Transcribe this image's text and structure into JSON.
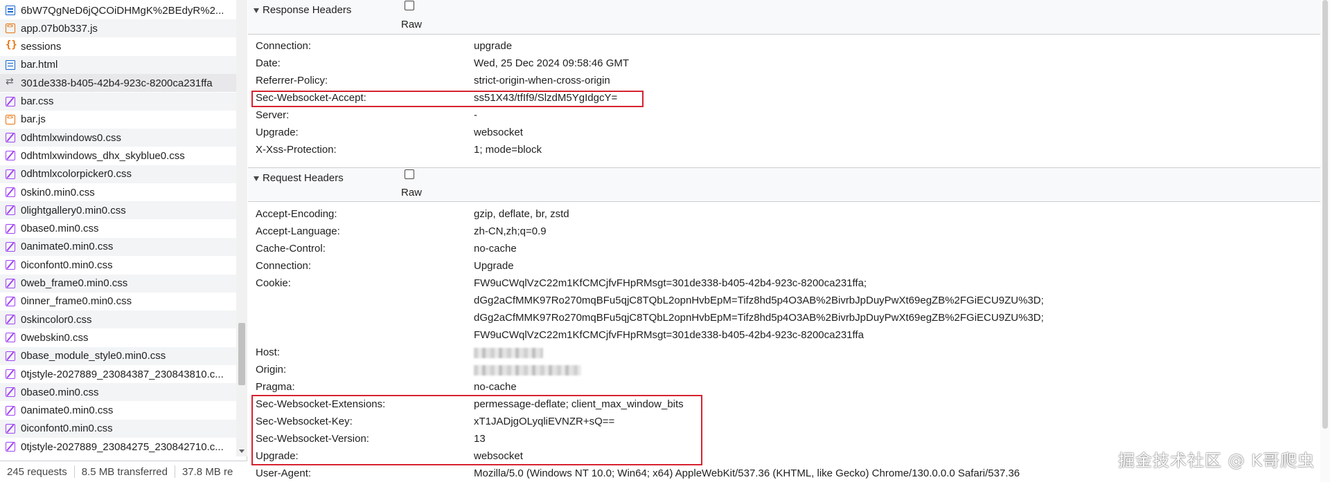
{
  "file_list": {
    "items": [
      {
        "name": "6bW7QgNeD6jQCOiDHMgK%2BEdyR%2...",
        "icon": "document-icon"
      },
      {
        "name": "app.07b0b337.js",
        "icon": "script-icon"
      },
      {
        "name": "sessions",
        "icon": "json-braces-icon"
      },
      {
        "name": "bar.html",
        "icon": "document-icon"
      },
      {
        "name": "301de338-b405-42b4-923c-8200ca231ffa",
        "icon": "websocket-icon"
      },
      {
        "name": "bar.css",
        "icon": "stylesheet-icon"
      },
      {
        "name": "bar.js",
        "icon": "script-icon"
      },
      {
        "name": "0dhtmlxwindows0.css",
        "icon": "stylesheet-icon"
      },
      {
        "name": "0dhtmlxwindows_dhx_skyblue0.css",
        "icon": "stylesheet-icon"
      },
      {
        "name": "0dhtmlxcolorpicker0.css",
        "icon": "stylesheet-icon"
      },
      {
        "name": "0skin0.min0.css",
        "icon": "stylesheet-icon"
      },
      {
        "name": "0lightgallery0.min0.css",
        "icon": "stylesheet-icon"
      },
      {
        "name": "0base0.min0.css",
        "icon": "stylesheet-icon"
      },
      {
        "name": "0animate0.min0.css",
        "icon": "stylesheet-icon"
      },
      {
        "name": "0iconfont0.min0.css",
        "icon": "stylesheet-icon"
      },
      {
        "name": "0web_frame0.min0.css",
        "icon": "stylesheet-icon"
      },
      {
        "name": "0inner_frame0.min0.css",
        "icon": "stylesheet-icon"
      },
      {
        "name": "0skincolor0.css",
        "icon": "stylesheet-icon"
      },
      {
        "name": "0webskin0.css",
        "icon": "stylesheet-icon"
      },
      {
        "name": "0base_module_style0.min0.css",
        "icon": "stylesheet-icon"
      },
      {
        "name": "0tjstyle-2027889_23084387_230843810.c...",
        "icon": "stylesheet-icon"
      },
      {
        "name": "0base0.min0.css",
        "icon": "stylesheet-icon"
      },
      {
        "name": "0animate0.min0.css",
        "icon": "stylesheet-icon"
      },
      {
        "name": "0iconfont0.min0.css",
        "icon": "stylesheet-icon"
      },
      {
        "name": "0tjstyle-2027889_23084275_230842710.c...",
        "icon": "stylesheet-icon"
      }
    ],
    "selected_index": 4
  },
  "status_bar": {
    "requests": "245 requests",
    "transferred": "8.5 MB transferred",
    "resources": "37.8 MB re"
  },
  "response_headers": {
    "title": "Response Headers",
    "raw_label": "Raw",
    "raw_checked": false,
    "rows": [
      {
        "name": "Connection:",
        "value": "upgrade"
      },
      {
        "name": "Date:",
        "value": "Wed, 25 Dec 2024 09:58:46 GMT"
      },
      {
        "name": "Referrer-Policy:",
        "value": "strict-origin-when-cross-origin"
      },
      {
        "name": "Sec-Websocket-Accept:",
        "value": "ss51X43/tfIf9/SlzdM5YgIdgcY="
      },
      {
        "name": "Server:",
        "value": "-"
      },
      {
        "name": "Upgrade:",
        "value": "websocket"
      },
      {
        "name": "X-Xss-Protection:",
        "value": "1; mode=block"
      }
    ]
  },
  "request_headers": {
    "title": "Request Headers",
    "raw_label": "Raw",
    "raw_checked": false,
    "rows": [
      {
        "name": "Accept-Encoding:",
        "value": "gzip, deflate, br, zstd"
      },
      {
        "name": "Accept-Language:",
        "value": "zh-CN,zh;q=0.9"
      },
      {
        "name": "Cache-Control:",
        "value": "no-cache"
      },
      {
        "name": "Connection:",
        "value": "Upgrade"
      },
      {
        "name": "Cookie:",
        "value": "FW9uCWqlVzC22m1KfCMCjfvFHpRMsgt=301de338-b405-42b4-923c-8200ca231ffa;"
      },
      {
        "name": "",
        "value": "dGg2aCfMMK97Ro270mqBFu5qjC8TQbL2opnHvbEpM=Tifz8hd5p4O3AB%2BivrbJpDuyPwXt69egZB%2FGiECU9ZU%3D;"
      },
      {
        "name": "",
        "value": "dGg2aCfMMK97Ro270mqBFu5qjC8TQbL2opnHvbEpM=Tifz8hd5p4O3AB%2BivrbJpDuyPwXt69egZB%2FGiECU9ZU%3D;"
      },
      {
        "name": "",
        "value": "FW9uCWqlVzC22m1KfCMCjfvFHpRMsgt=301de338-b405-42b4-923c-8200ca231ffa"
      },
      {
        "name": "Host:",
        "value": "",
        "redacted": true
      },
      {
        "name": "Origin:",
        "value": "",
        "redacted": true
      },
      {
        "name": "Pragma:",
        "value": "no-cache"
      },
      {
        "name": "Sec-Websocket-Extensions:",
        "value": "permessage-deflate; client_max_window_bits"
      },
      {
        "name": "Sec-Websocket-Key:",
        "value": "xT1JADjgOLyqliEVNZR+sQ=="
      },
      {
        "name": "Sec-Websocket-Version:",
        "value": "13"
      },
      {
        "name": "Upgrade:",
        "value": "websocket"
      },
      {
        "name": "User-Agent:",
        "value": "Mozilla/5.0 (Windows NT 10.0; Win64; x64) AppleWebKit/537.36 (KHTML, like Gecko) Chrome/130.0.0.0 Safari/537.36"
      }
    ]
  },
  "watermark": "掘金技术社区 @ K哥爬虫",
  "colors": {
    "highlight": "#d6222f",
    "selected_row": "#e8e8ea",
    "alt_row": "#f2f4f6"
  }
}
